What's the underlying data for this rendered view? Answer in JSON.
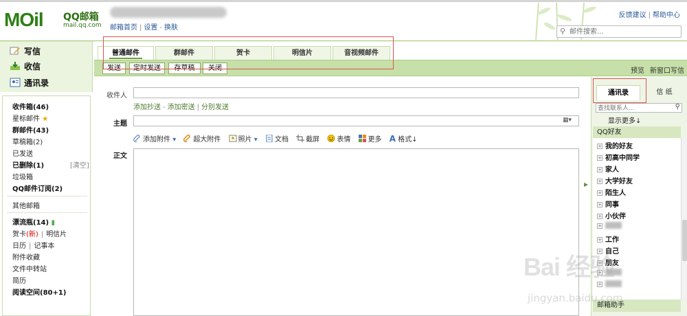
{
  "header": {
    "logo_text": "MOil",
    "logo_title": "QQ邮箱",
    "logo_subtitle": "mail.qq.com",
    "home_links": [
      "邮箱首页",
      "设置",
      "换肤"
    ],
    "top_links": [
      "反馈建议",
      "帮助中心"
    ],
    "search_placeholder": "邮件搜索..."
  },
  "sidebar": {
    "quick": [
      {
        "label": "写信",
        "icon": "pencil-icon"
      },
      {
        "label": "收信",
        "icon": "inbox-download-icon"
      },
      {
        "label": "通讯录",
        "icon": "contacts-icon"
      }
    ],
    "folders": {
      "inbox": "收件箱(46)",
      "starred": "星标邮件",
      "group": "群邮件(43)",
      "drafts": "草稿箱(2)",
      "sent": "已发送",
      "deleted": "已删除(1)",
      "clear": "[清空]",
      "junk": "垃圾箱",
      "subscribe": "QQ邮件订阅(2)",
      "other": "其他邮箱",
      "drift": "漂流瓶(14)",
      "card": "贺卡",
      "card_new": "(新)",
      "postcard": "明信片",
      "calendar": "日历",
      "notes": "记事本",
      "attachments": "附件收藏",
      "transfer": "文件中转站",
      "resume": "简历",
      "reading": "阅读空间(80+1)"
    }
  },
  "compose": {
    "tabs": [
      "普通邮件",
      "群邮件",
      "贺卡",
      "明信片",
      "音视频邮件"
    ],
    "toolbar_buttons": [
      "发送",
      "定时发送",
      "存草稿",
      "关闭"
    ],
    "toolbar_right": [
      "预览",
      "新窗口写信"
    ],
    "recipient_label": "收件人",
    "recipient_options": [
      "添加抄送",
      "添加密送",
      "分别发送"
    ],
    "subject_label": "主题",
    "format_items": [
      "添加附件",
      "超大附件",
      "照片",
      "文档",
      "截屏",
      "表情",
      "更多",
      "格式↓"
    ],
    "body_label": "正文"
  },
  "right_panel": {
    "tabs": [
      "通讯录",
      "信 纸"
    ],
    "search_placeholder": "查找联系人...",
    "show_more": "显示更多↓",
    "group_header": "QQ好友",
    "contacts": [
      "我的好友",
      "初高中同学",
      "家人",
      "大学好友",
      "陌生人",
      "同事",
      "小伙伴",
      "",
      "工作",
      "自己",
      "朋友",
      "",
      ""
    ],
    "footer": "邮箱助手"
  },
  "watermark": {
    "main": "Bai 经验",
    "sub": "jingyan.baidu.com"
  }
}
